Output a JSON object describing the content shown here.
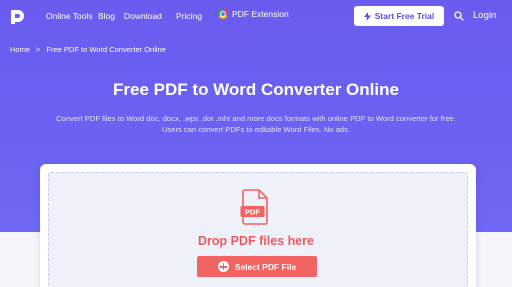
{
  "nav": {
    "links": [
      "Online Tools",
      "Blog",
      "Download",
      "Pricing"
    ],
    "extension_label": "PDF Extension",
    "trial_label": "Start Free Trial",
    "login_label": "Login"
  },
  "breadcrumb": {
    "home": "Home",
    "separator": ">",
    "current": "Free PDF to Word Converter Online"
  },
  "hero": {
    "title": "Free PDF to Word Converter Online",
    "description_line1": "Convert PDF files to Word doc, docx, .wps .dot .mht and more docs formats with online PDF to Word converter for free.",
    "description_line2": "Users can convert PDFs to editable Word Files. No ads."
  },
  "upload": {
    "file_type_label": "PDF",
    "drop_text": "Drop PDF files here",
    "select_label": "Select PDF File"
  },
  "colors": {
    "brand": "#6b5cf0",
    "accent_red": "#f26361"
  }
}
